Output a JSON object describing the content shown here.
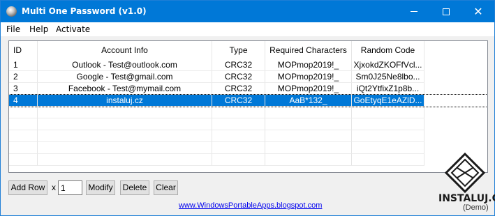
{
  "window": {
    "title": "Multi One Password (v1.0)"
  },
  "menu": {
    "file": "File",
    "help": "Help",
    "activate": "Activate"
  },
  "table": {
    "headers": [
      "ID",
      "Account Info",
      "Type",
      "Required Characters",
      "Random Code"
    ],
    "rows": [
      {
        "id": "1",
        "account": "Outlook - Test@outlook.com",
        "type": "CRC32",
        "required": "MOPmop2019!_",
        "random": "XjxokdZKOFfVcl..."
      },
      {
        "id": "2",
        "account": "Google - Test@gmail.com",
        "type": "CRC32",
        "required": "MOPmop2019!_",
        "random": "Sm0J25Ne8lbo..."
      },
      {
        "id": "3",
        "account": "Facebook - Test@mymail.com",
        "type": "CRC32",
        "required": "MOPmop2019!_",
        "random": "iQt2YtfixZ1p8b..."
      },
      {
        "id": "4",
        "account": "instaluj.cz",
        "type": "CRC32",
        "required": "AaB*132_",
        "random": "GoEtyqE1eAZlD..."
      }
    ]
  },
  "controls": {
    "add_row": "Add Row",
    "times": "x",
    "count": "1",
    "modify": "Modify",
    "delete": "Delete",
    "clear": "Clear"
  },
  "footer": {
    "link": "www.WindowsPortableApps.blogspot.com"
  },
  "watermark": {
    "text": "INSTALUJ.CZ",
    "demo": "(Demo)"
  }
}
